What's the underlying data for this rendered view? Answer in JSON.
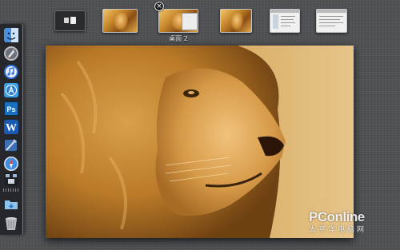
{
  "spaces_bar": {
    "spaces": [
      {
        "kind": "dashboard"
      },
      {
        "kind": "desktop"
      },
      {
        "kind": "desktop",
        "label": "桌面 2",
        "close": "×"
      },
      {
        "kind": "desktop"
      },
      {
        "kind": "app-fullscreen"
      },
      {
        "kind": "app-fullscreen"
      }
    ]
  },
  "dock": {
    "items": [
      {
        "icon": "finder-icon"
      },
      {
        "icon": "launchpad-icon"
      },
      {
        "icon": "itunes-icon"
      },
      {
        "icon": "app-store-icon"
      },
      {
        "icon": "photoshop-icon",
        "glyph": "Ps"
      },
      {
        "icon": "word-icon",
        "glyph": "W"
      },
      {
        "icon": "xcode-icon"
      },
      {
        "icon": "safari-icon"
      },
      {
        "icon": "mission-control-icon"
      },
      {
        "icon": "downloads-folder-icon"
      },
      {
        "icon": "trash-icon"
      }
    ]
  },
  "watermark": {
    "brand": "PConline",
    "sub": "太平洋电脑网"
  },
  "colors": {
    "wallpaper": "#4f5155",
    "lion_mane": "#c8882e",
    "lion_face": "#e2ad5c",
    "backdrop": "#e6c07a"
  }
}
